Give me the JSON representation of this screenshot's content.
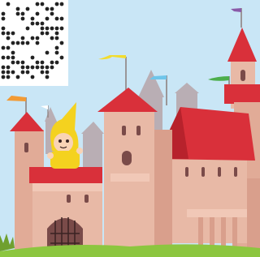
{
  "scene": {
    "description_labels": [],
    "colors": {
      "sky": "#c9e6f6",
      "castle_wall": "#e8b9a6",
      "castle_shadow": "#d99f8c",
      "roof": "#d9303a",
      "roof_dark": "#b7222c",
      "grass": "#8cc63f",
      "hero_yellow": "#f4d21f"
    },
    "qr_code_icon": "qr-code-icon",
    "flags": [
      "yellow-flag-icon",
      "blue-flag-icon",
      "green-flag-icon",
      "orange-flag-icon",
      "purple-flag-icon",
      "white-flag-icon"
    ],
    "character": "yellow-hooded-child-icon"
  }
}
